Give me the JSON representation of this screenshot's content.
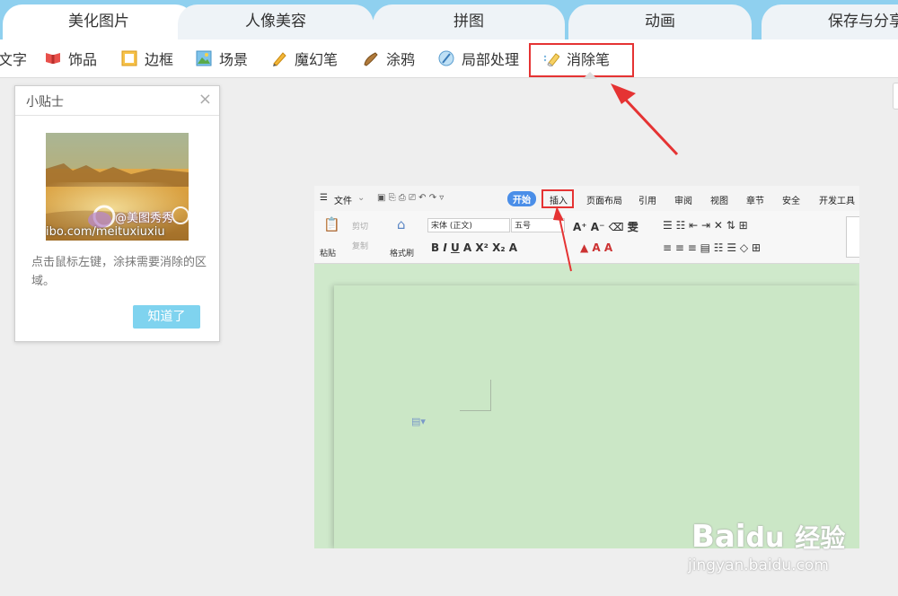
{
  "tabs": [
    {
      "label": "美化图片",
      "active": true
    },
    {
      "label": "人像美容",
      "active": false
    },
    {
      "label": "拼图",
      "active": false
    },
    {
      "label": "动画",
      "active": false
    },
    {
      "label": "保存与分享",
      "active": false
    }
  ],
  "toolbar": {
    "items": [
      {
        "label": "文字",
        "icon": "text-icon"
      },
      {
        "label": "饰品",
        "icon": "ribbon-icon"
      },
      {
        "label": "边框",
        "icon": "frame-icon"
      },
      {
        "label": "场景",
        "icon": "scene-icon"
      },
      {
        "label": "魔幻笔",
        "icon": "magic-pen-icon"
      },
      {
        "label": "涂鸦",
        "icon": "paint-icon"
      },
      {
        "label": "局部处理",
        "icon": "partial-process-icon"
      },
      {
        "label": "消除笔",
        "icon": "eraser-pen-icon"
      }
    ],
    "highlight_color": "#e53333"
  },
  "tips": {
    "title": "小贴士",
    "close": "×",
    "image_caption": "@美图秀秀",
    "image_url_text": "ibo.com/meituxiuxiu",
    "text": "点击鼠标左键，涂抹需要消除的区域。",
    "button": "知道了"
  },
  "wps": {
    "menu": [
      "文件",
      "开始",
      "插入",
      "页面布局",
      "引用",
      "审阅",
      "视图",
      "章节",
      "安全",
      "开发工具"
    ],
    "ribbon": {
      "paste": "粘贴",
      "cut": "剪切",
      "copy": "复制",
      "format_painter": "格式刷",
      "font": "宋体 (正文)",
      "size": "五号"
    }
  },
  "watermark": {
    "brand": "Bai",
    "brand2": "经验",
    "url": "jingyan.baidu.com"
  }
}
